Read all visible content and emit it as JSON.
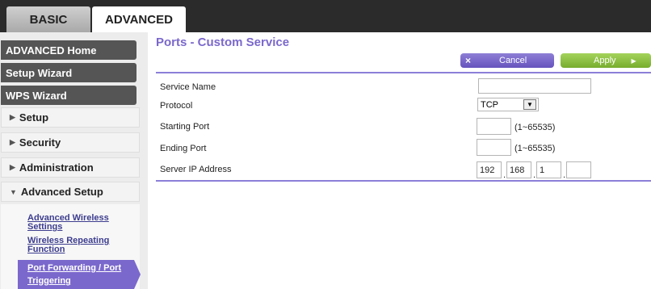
{
  "tabs": {
    "basic": "BASIC",
    "advanced": "ADVANCED"
  },
  "sidebar": {
    "items": [
      {
        "label": "ADVANCED Home"
      },
      {
        "label": "Setup Wizard"
      },
      {
        "label": "WPS Wizard"
      },
      {
        "label": "Setup"
      },
      {
        "label": "Security"
      },
      {
        "label": "Administration"
      },
      {
        "label": "Advanced Setup"
      }
    ],
    "arrows": {
      "collapsed": "▶",
      "expanded": "▼"
    },
    "sublinks": {
      "advanced_wireless_1": "Advanced Wireless",
      "advanced_wireless_2": "Settings",
      "wireless_repeating_1": "Wireless Repeating",
      "wireless_repeating_2": "Function",
      "port_forwarding_1": "Port Forwarding / Port",
      "port_forwarding_2": "Triggering"
    }
  },
  "main": {
    "title": "Ports - Custom Service",
    "cancel_icon": "×",
    "cancel_label": "Cancel",
    "apply_label": "Apply",
    "apply_icon": "▶",
    "fields": {
      "service_name_label": "Service Name",
      "service_name_value": "",
      "protocol_label": "Protocol",
      "protocol_value": "TCP",
      "protocol_dropdown_icon": "▼",
      "starting_port_label": "Starting Port",
      "starting_port_value": "",
      "starting_port_range": "(1~65535)",
      "ending_port_label": "Ending Port",
      "ending_port_value": "",
      "ending_port_range": "(1~65535)",
      "server_ip_label": "Server IP Address",
      "ip_octet_1": "192",
      "ip_octet_2": "168",
      "ip_octet_3": "1",
      "ip_octet_4": "",
      "ip_separator": "."
    }
  },
  "colors": {
    "accent": "#7b68cc",
    "apply": "#8bc34a",
    "topbar": "#2b2b2b",
    "nav_dark": "#555556"
  }
}
